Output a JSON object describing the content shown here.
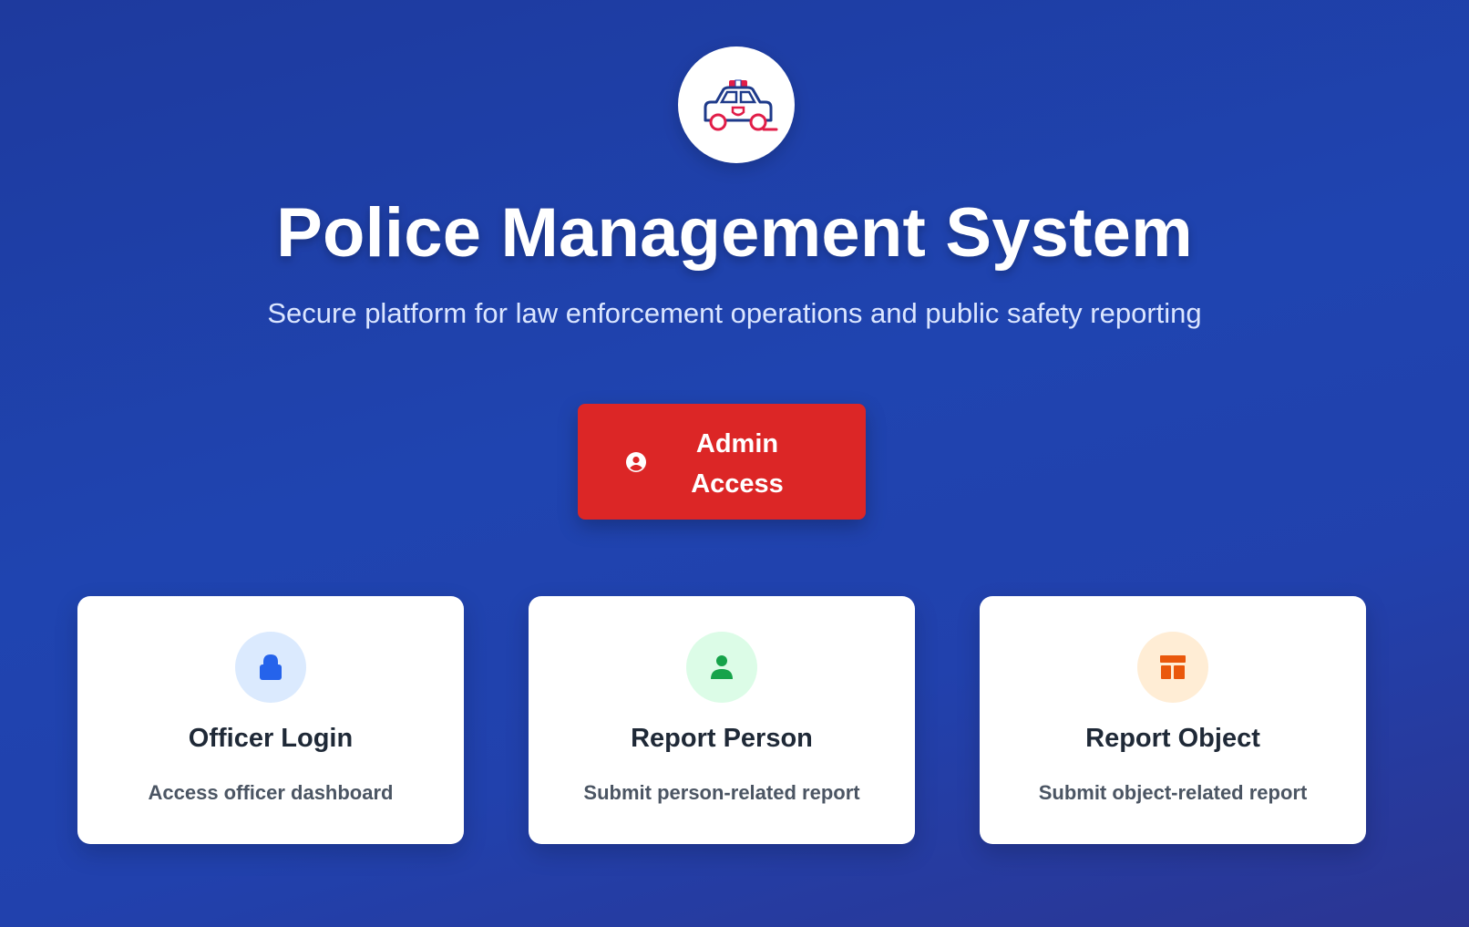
{
  "header": {
    "logo_icon": "police-car-icon",
    "title": "Police Management System",
    "subtitle": "Secure platform for law enforcement operations and public safety reporting"
  },
  "admin_button": {
    "label": "Admin Access",
    "icon": "user-circle-icon",
    "color": "#dc2626"
  },
  "cards": [
    {
      "title": "Officer Login",
      "description": "Access officer dashboard",
      "icon": "lock-icon",
      "icon_color": "#2563eb",
      "icon_bg": "#dbeafe"
    },
    {
      "title": "Report Person",
      "description": "Submit person-related report",
      "icon": "user-icon",
      "icon_color": "#16a34a",
      "icon_bg": "#dcfce7"
    },
    {
      "title": "Report Object",
      "description": "Submit object-related report",
      "icon": "box-icon",
      "icon_color": "#ea580c",
      "icon_bg": "#ffedd5"
    }
  ],
  "colors": {
    "background": "#1f44b0",
    "card_title": "#1f2937",
    "card_desc": "#4b5563"
  }
}
